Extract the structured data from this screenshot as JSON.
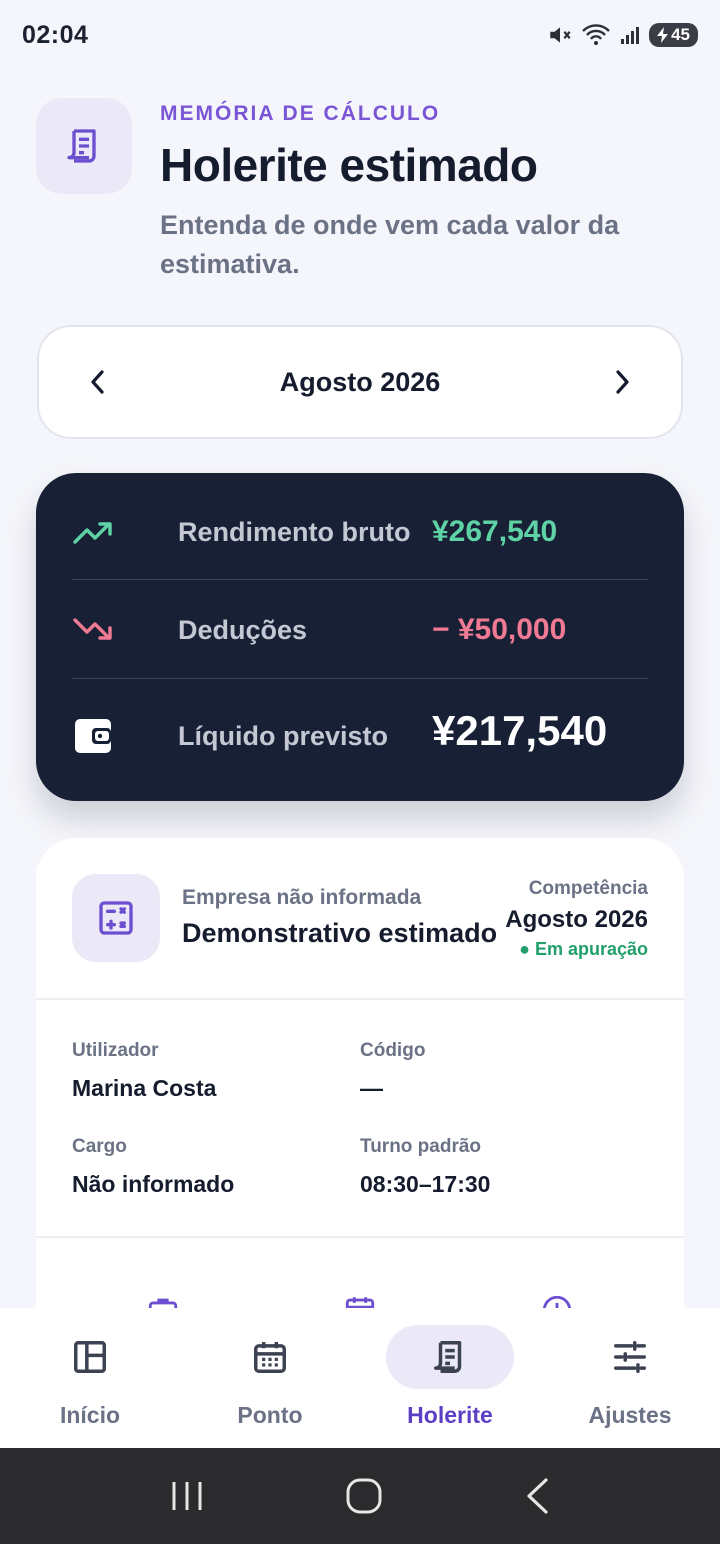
{
  "status": {
    "time": "02:04",
    "battery": "45"
  },
  "header": {
    "eyebrow": "MEMÓRIA DE CÁLCULO",
    "title": "Holerite estimado",
    "subtitle": "Entenda de onde vem cada valor da estimativa."
  },
  "month_selector": {
    "label": "Agosto 2026"
  },
  "summary": {
    "gross": {
      "label": "Rendimento bruto",
      "value": "¥267,540",
      "color": "#5fd3a5"
    },
    "deductions": {
      "label": "Deduções",
      "value": "− ¥50,000",
      "color": "#f07a93"
    },
    "net": {
      "label": "Líquido previsto",
      "value": "¥217,540",
      "color": "#ffffff"
    }
  },
  "detail": {
    "company": "Empresa não informada",
    "document": "Demonstrativo estimado",
    "competence_label": "Competência",
    "competence_value": "Agosto 2026",
    "competence_status": "● Em apuração",
    "fields": [
      {
        "label": "Utilizador",
        "value": "Marina Costa"
      },
      {
        "label": "Código",
        "value": "—"
      },
      {
        "label": "Cargo",
        "value": "Não informado"
      },
      {
        "label": "Turno padrão",
        "value": "08:30–17:30"
      }
    ]
  },
  "bottom_nav": {
    "items": [
      {
        "label": "Início",
        "icon": "dashboard-icon"
      },
      {
        "label": "Ponto",
        "icon": "calendar-icon"
      },
      {
        "label": "Holerite",
        "icon": "receipt-icon",
        "active": true
      },
      {
        "label": "Ajustes",
        "icon": "sliders-icon"
      }
    ]
  },
  "colors": {
    "accent": "#7a55d6",
    "dark_card": "#172035",
    "success": "#22a06b"
  }
}
